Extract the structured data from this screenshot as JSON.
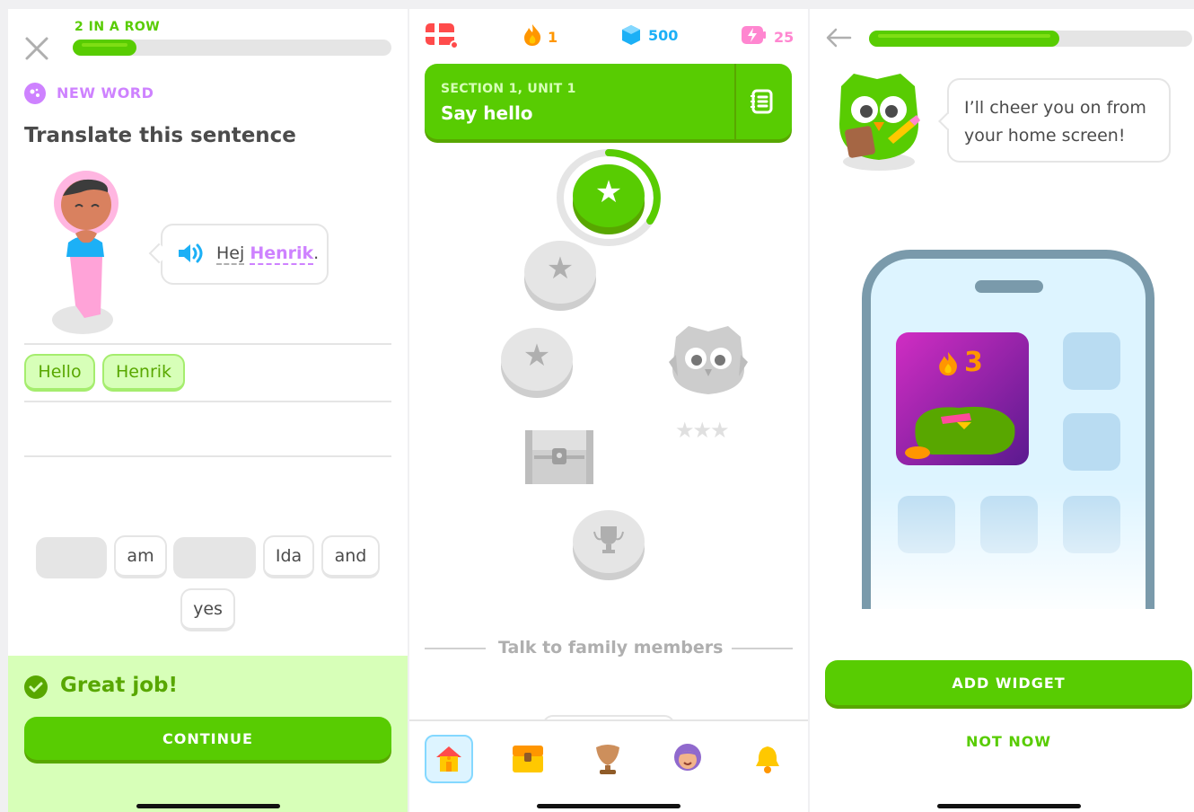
{
  "lesson": {
    "streak_label": "2 IN A ROW",
    "progress": 0.2,
    "badge_label": "NEW WORD",
    "prompt_title": "Translate this sentence",
    "sentence_word1": "Hej",
    "sentence_word2": "Henrik",
    "sentence_punct": ".",
    "answer_chips": [
      "Hello",
      "Henrik"
    ],
    "word_bank": [
      "am",
      "Ida",
      "and",
      "yes"
    ],
    "feedback_title": "Great job!",
    "continue_label": "CONTINUE"
  },
  "path": {
    "streak_count": "1",
    "gems_count": "500",
    "energy_count": "25",
    "unit_subtitle": "SECTION 1, UNIT 1",
    "unit_title": "Say hello",
    "section_divider": "Talk to family members",
    "tabs": [
      "home-tab",
      "quests-chest-tab",
      "leagues-tab",
      "profile-tab",
      "notifications-tab"
    ]
  },
  "widget": {
    "progress": 0.59,
    "speech_line1": "I’ll cheer you on from",
    "speech_line2": "your home screen!",
    "widget_streak": "3",
    "add_label": "ADD WIDGET",
    "not_now_label": "NOT NOW"
  },
  "colors": {
    "green": "#58cc02",
    "green_dark": "#58a700",
    "purple": "#ce82ff",
    "blue": "#1cb0f6",
    "orange": "#ff9600",
    "pink": "#ff4b4b"
  }
}
